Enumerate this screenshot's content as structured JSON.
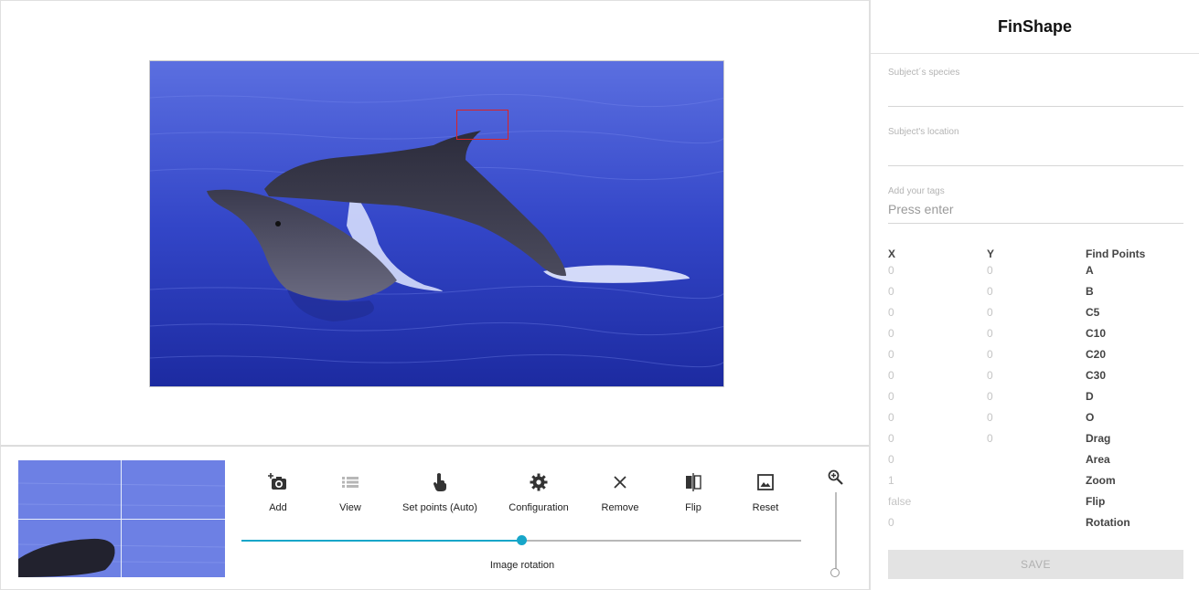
{
  "app": {
    "title": "FinShape"
  },
  "form": {
    "species": {
      "label": "Subject´s species",
      "value": ""
    },
    "location": {
      "label": "Subject's location",
      "value": ""
    },
    "tags": {
      "label": "Add your tags",
      "placeholder": "Press enter"
    }
  },
  "points_table": {
    "headers": {
      "x": "X",
      "y": "Y",
      "points": "Find Points"
    },
    "rows": [
      {
        "x": "0",
        "y": "0",
        "name": "A"
      },
      {
        "x": "0",
        "y": "0",
        "name": "B"
      },
      {
        "x": "0",
        "y": "0",
        "name": "C5"
      },
      {
        "x": "0",
        "y": "0",
        "name": "C10"
      },
      {
        "x": "0",
        "y": "0",
        "name": "C20"
      },
      {
        "x": "0",
        "y": "0",
        "name": "C30"
      },
      {
        "x": "0",
        "y": "0",
        "name": "D"
      },
      {
        "x": "0",
        "y": "0",
        "name": "O"
      },
      {
        "x": "0",
        "y": "0",
        "name": "Drag"
      },
      {
        "x": "0",
        "y": "",
        "name": "Area"
      },
      {
        "x": "1",
        "y": "",
        "name": "Zoom"
      },
      {
        "x": "false",
        "y": "",
        "name": "Flip"
      },
      {
        "x": "0",
        "y": "",
        "name": "Rotation"
      }
    ]
  },
  "save_button": {
    "label": "SAVE"
  },
  "toolbar": {
    "add": {
      "label": "Add",
      "icon": "add-photo-icon"
    },
    "view": {
      "label": "View",
      "icon": "list-icon"
    },
    "set_points": {
      "label": "Set points (Auto)",
      "icon": "touch-icon"
    },
    "configuration": {
      "label": "Configuration",
      "icon": "gear-icon"
    },
    "remove": {
      "label": "Remove",
      "icon": "close-icon"
    },
    "flip": {
      "label": "Flip",
      "icon": "flip-icon"
    },
    "reset": {
      "label": "Reset",
      "icon": "image-icon"
    }
  },
  "rotation_slider": {
    "label": "Image rotation",
    "value_fraction": 0.5
  },
  "zoom_slider": {
    "icon": "zoom-in-icon",
    "value_fraction": 0.0
  },
  "colors": {
    "accent": "#17a6c9",
    "selection_box": "#dd2222",
    "save_disabled_bg": "#e3e3e3"
  }
}
